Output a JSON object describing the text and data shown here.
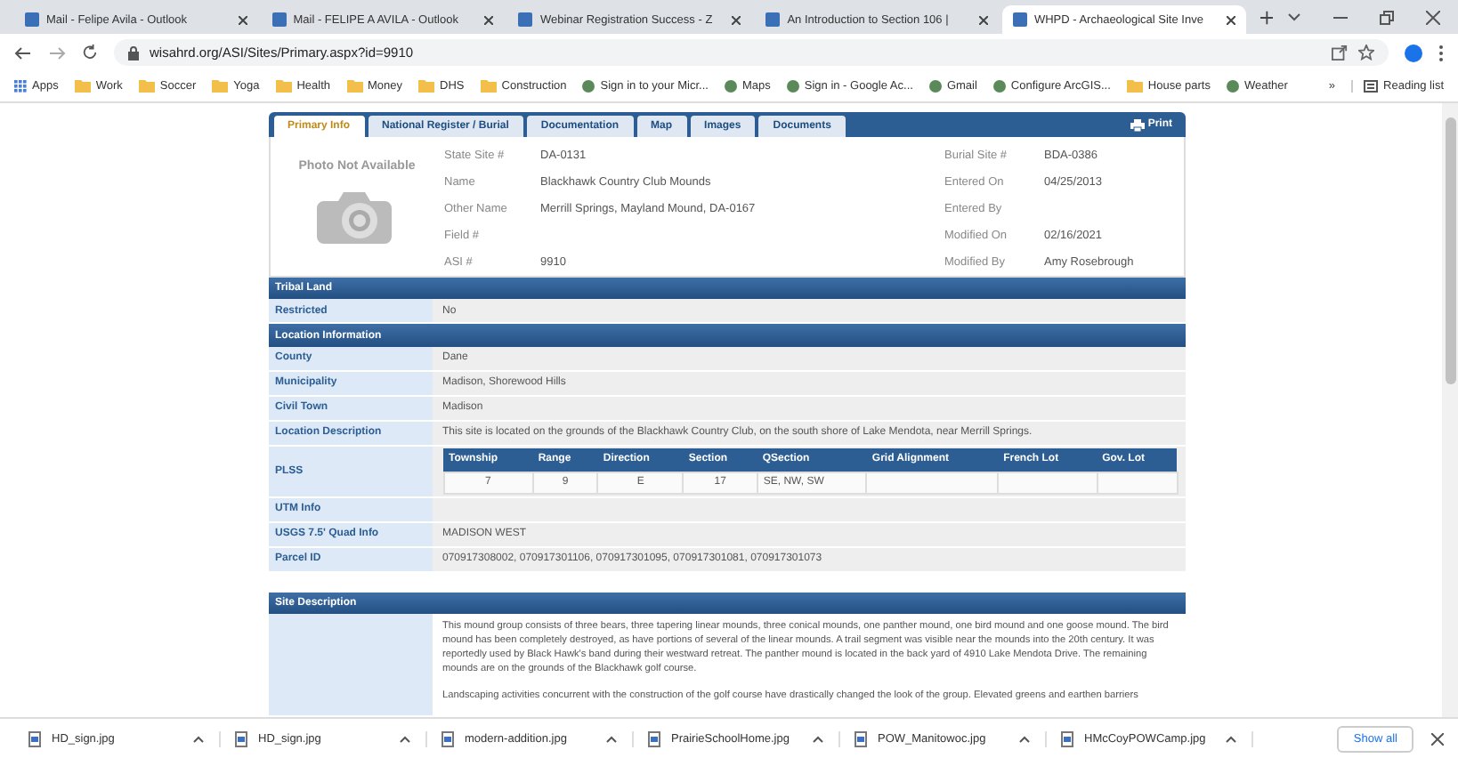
{
  "browser": {
    "tabs": [
      {
        "title": "Mail - Felipe Avila - Outlook",
        "selected": false
      },
      {
        "title": "Mail - FELIPE A AVILA - Outlook",
        "selected": false
      },
      {
        "title": "Webinar Registration Success - Z",
        "selected": false
      },
      {
        "title": "An Introduction to Section 106 |",
        "selected": false
      },
      {
        "title": "WHPD - Archaeological Site Inve",
        "selected": true
      }
    ],
    "url": "wisahrd.org/ASI/Sites/Primary.aspx?id=9910",
    "bookmarks": [
      {
        "label": "Apps",
        "kind": "apps"
      },
      {
        "label": "Work",
        "kind": "folder"
      },
      {
        "label": "Soccer",
        "kind": "folder"
      },
      {
        "label": "Yoga",
        "kind": "folder"
      },
      {
        "label": "Health",
        "kind": "folder"
      },
      {
        "label": "Money",
        "kind": "folder"
      },
      {
        "label": "DHS",
        "kind": "folder"
      },
      {
        "label": "Construction",
        "kind": "folder"
      },
      {
        "label": "Sign in to your Micr...",
        "kind": "link"
      },
      {
        "label": "Maps",
        "kind": "link"
      },
      {
        "label": "Sign in - Google Ac...",
        "kind": "link"
      },
      {
        "label": "Gmail",
        "kind": "link"
      },
      {
        "label": "Configure ArcGIS...",
        "kind": "link"
      },
      {
        "label": "House parts",
        "kind": "folder"
      },
      {
        "label": "Weather",
        "kind": "link"
      }
    ],
    "more_bookmarks": "»",
    "reading_list": "Reading list"
  },
  "page": {
    "tabs": [
      {
        "label": "Primary Info",
        "selected": true
      },
      {
        "label": "National Register / Burial",
        "selected": false
      },
      {
        "label": "Documentation",
        "selected": false
      },
      {
        "label": "Map",
        "selected": false
      },
      {
        "label": "Images",
        "selected": false
      },
      {
        "label": "Documents",
        "selected": false
      }
    ],
    "print": "Print",
    "photo_text": "Photo Not Available",
    "info_left": [
      {
        "label": "State Site #",
        "value": "DA-0131"
      },
      {
        "label": "Name",
        "value": "Blackhawk Country Club Mounds"
      },
      {
        "label": "Other Name",
        "value": "Merrill Springs, Mayland Mound, DA-0167"
      },
      {
        "label": "Field #"
      },
      {
        "label": "ASI #",
        "value": "9910"
      }
    ],
    "info_right": [
      {
        "label": "Burial Site #",
        "value": "BDA-0386"
      },
      {
        "label": "Entered On",
        "value": "04/25/2013"
      },
      {
        "label": "Entered By"
      },
      {
        "label": "Modified On",
        "value": "02/16/2021"
      },
      {
        "label": "Modified By",
        "value": "Amy Rosebrough"
      }
    ],
    "sections": [
      {
        "title": "Tribal Land",
        "rows": [
          {
            "label": "Restricted",
            "kind": "text",
            "value": "No"
          }
        ]
      },
      {
        "title": "Location Information",
        "rows": [
          {
            "label": "County",
            "kind": "text",
            "value": "Dane"
          },
          {
            "label": "Municipality",
            "kind": "text",
            "value": "Madison, Shorewood Hills"
          },
          {
            "label": "Civil Town",
            "kind": "text",
            "value": "Madison"
          },
          {
            "label": "Location Description",
            "kind": "text",
            "value": "This site is located on the grounds of the Blackhawk Country Club, on the south shore of Lake Mendota, near Merrill Springs."
          },
          {
            "label": "PLSS",
            "kind": "plss",
            "columns": [
              "Township",
              "Range",
              "Direction",
              "Section",
              "QSection",
              "Grid Alignment",
              "French Lot",
              "Gov. Lot"
            ],
            "cells": [
              "7",
              "9",
              "E",
              "17",
              "SE, NW, SW",
              null,
              null,
              null
            ]
          },
          {
            "label": "UTM Info",
            "kind": "text"
          },
          {
            "label": "USGS 7.5' Quad Info",
            "kind": "text",
            "value": "MADISON WEST"
          },
          {
            "label": "Parcel ID",
            "kind": "text",
            "value": "070917308002, 070917301106, 070917301095, 070917301081, 070917301073"
          }
        ]
      }
    ],
    "site_description": {
      "title": "Site Description",
      "paragraphs": [
        "This mound group consists of three bears, three tapering linear mounds, three conical mounds, one panther mound, one bird mound and one goose mound. The bird mound has been completely destroyed, as have portions of several of the linear mounds. A trail segment was visible near the mounds into the 20th century. It was reportedly used by Black Hawk's band during their westward retreat. The panther mound is located in the back yard of 4910 Lake Mendota Drive. The remaining mounds are on the grounds of the Blackhawk golf course.",
        "Landscaping activities concurrent with the construction of the golf course have drastically changed the look of the group. Elevated greens and earthen barriers"
      ]
    }
  },
  "downloads": {
    "files": [
      "HD_sign.jpg",
      "HD_sign.jpg",
      "modern-addition.jpg",
      "PrairieSchoolHome.jpg",
      "POW_Manitowoc.jpg",
      "HMcCoyPOWCamp.jpg"
    ],
    "show_all": "Show all"
  }
}
